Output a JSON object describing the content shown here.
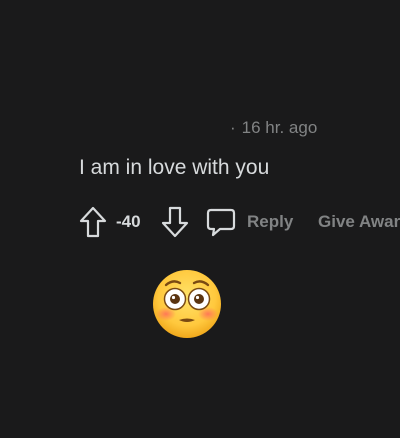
{
  "comment": {
    "timestamp": "16 hr. ago",
    "separator": "·",
    "text": "I am in love with you",
    "score": "-40",
    "reply_label": "Reply",
    "award_label": "Give Award",
    "icons": {
      "upvote": "arrow-up-icon",
      "downvote": "arrow-down-icon",
      "reply": "speech-bubble-icon"
    }
  },
  "reaction": {
    "emoji": "flushed-face-emoji"
  },
  "colors": {
    "background": "#1a1a1b",
    "text": "#d7dadc",
    "muted": "#818384"
  }
}
